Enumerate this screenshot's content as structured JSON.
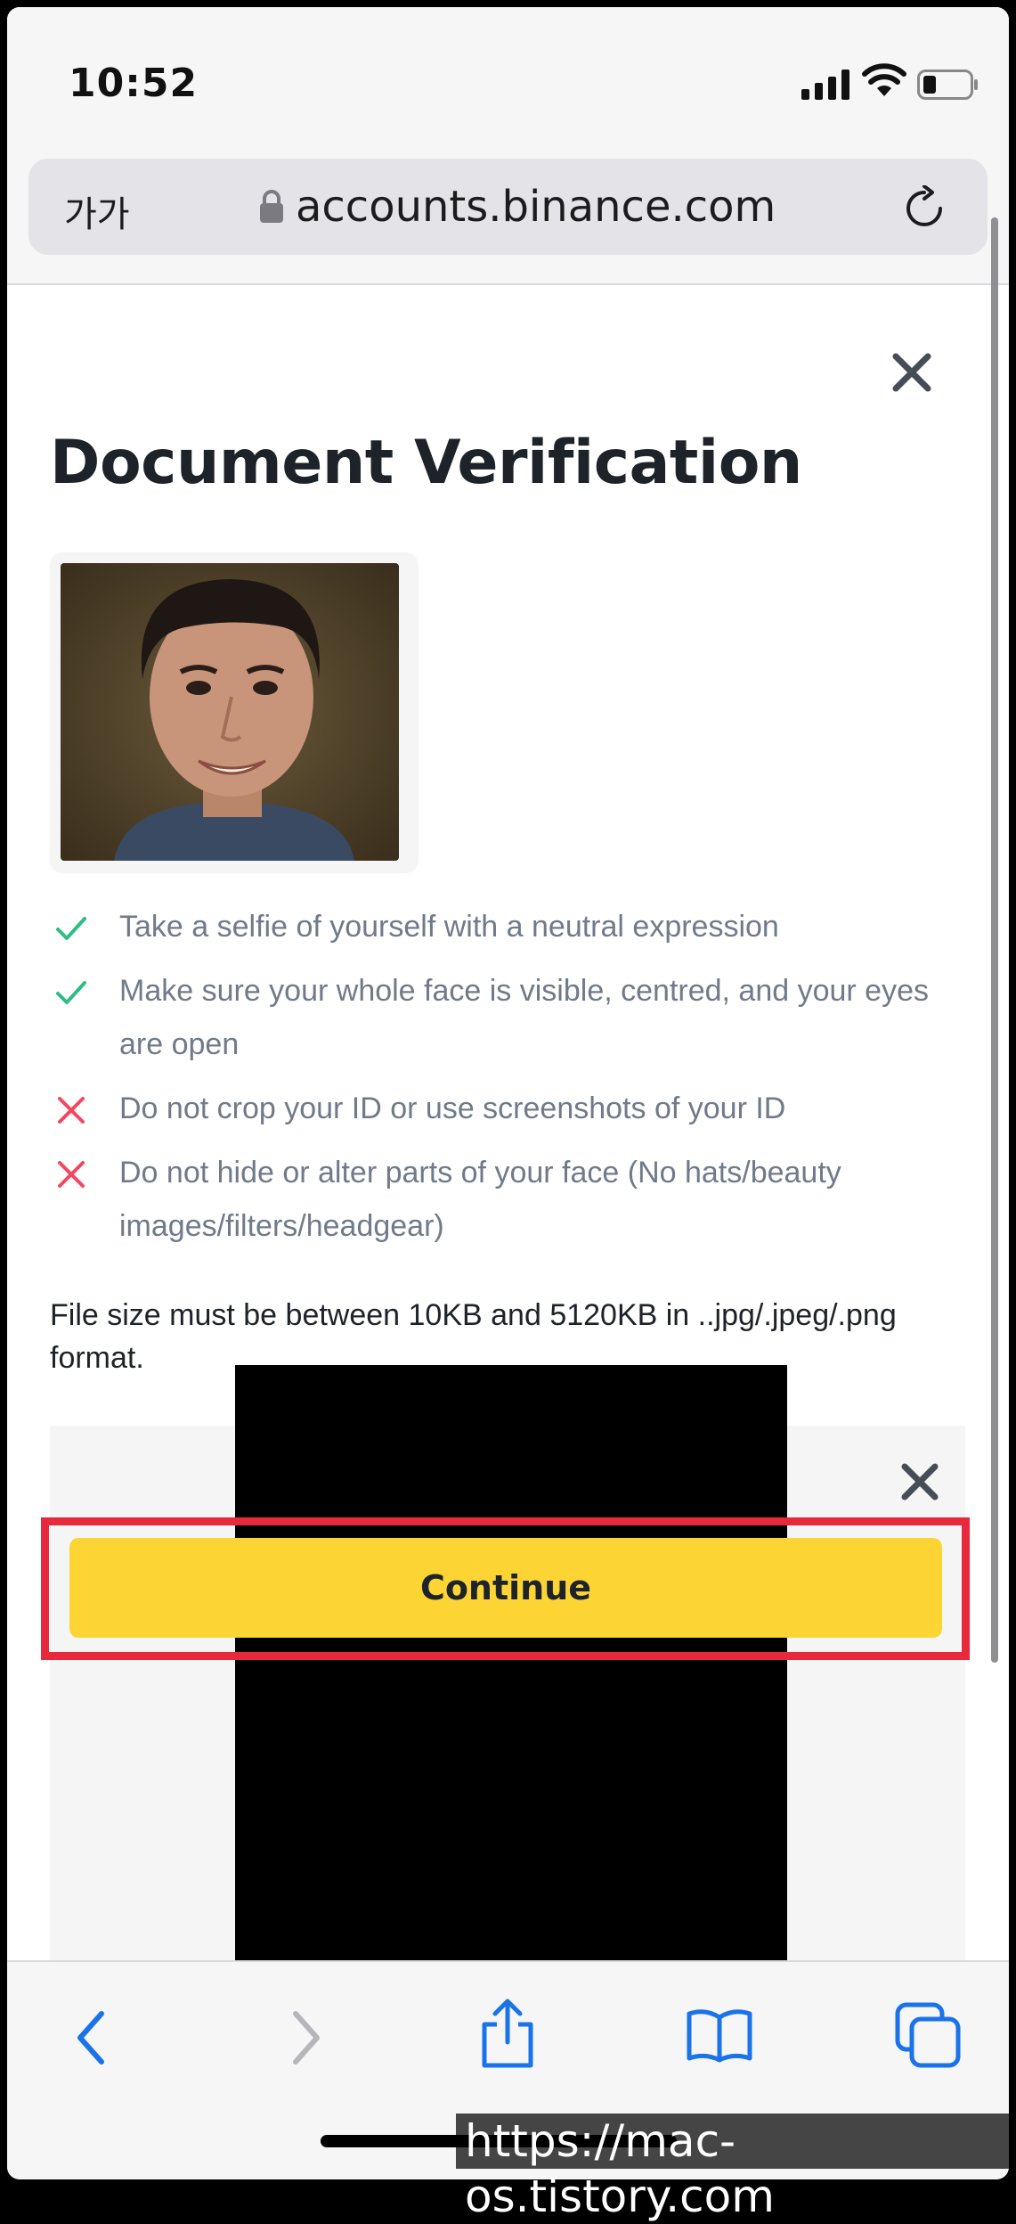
{
  "status_bar": {
    "time": "10:52"
  },
  "browser": {
    "text_size_button": "가가",
    "url": "accounts.binance.com"
  },
  "page": {
    "title": "Document Verification",
    "rules": [
      {
        "type": "do",
        "text": "Take a selfie of yourself with a neutral expression"
      },
      {
        "type": "do",
        "text": "Make sure your whole face is visible, centred, and your eyes are open"
      },
      {
        "type": "dont",
        "text": "Do not crop your ID or use screenshots of your ID"
      },
      {
        "type": "dont",
        "text": "Do not hide or alter parts of your face (No hats/beauty images/filters/headgear)"
      }
    ],
    "file_size_note": "File size must be between 10KB and 5120KB in ..jpg/.jpeg/.png format.",
    "continue_label": "Continue"
  },
  "colors": {
    "accent_yellow": "#fcd535",
    "check_green": "#2ebd85",
    "cross_red": "#f6465d",
    "highlight_red": "#e8283d",
    "ios_blue": "#1a73e8"
  },
  "icons": {
    "close": "close-icon",
    "lock": "lock-icon",
    "reload": "reload-icon",
    "back": "back-icon",
    "forward": "forward-icon",
    "share": "share-icon",
    "bookmarks": "bookmarks-icon",
    "tabs": "tabs-icon"
  },
  "watermark": "https://mac-os.tistory.com"
}
